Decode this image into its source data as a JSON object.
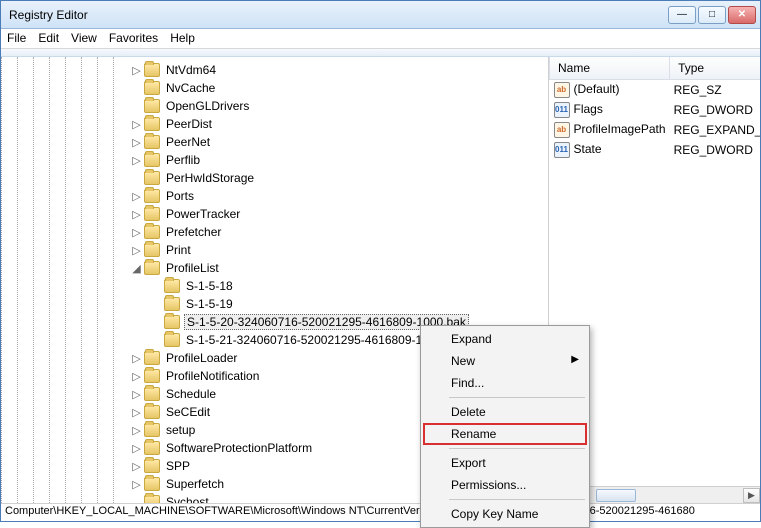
{
  "window": {
    "title": "Registry Editor"
  },
  "menus": [
    "File",
    "Edit",
    "View",
    "Favorites",
    "Help"
  ],
  "tree": {
    "pad_base": 126,
    "items": [
      {
        "tw": "▷",
        "label": "NtVdm64",
        "d": 0
      },
      {
        "tw": "",
        "label": "NvCache",
        "d": 0
      },
      {
        "tw": "",
        "label": "OpenGLDrivers",
        "d": 0
      },
      {
        "tw": "▷",
        "label": "PeerDist",
        "d": 0
      },
      {
        "tw": "▷",
        "label": "PeerNet",
        "d": 0
      },
      {
        "tw": "▷",
        "label": "Perflib",
        "d": 0
      },
      {
        "tw": "",
        "label": "PerHwIdStorage",
        "d": 0
      },
      {
        "tw": "▷",
        "label": "Ports",
        "d": 0
      },
      {
        "tw": "▷",
        "label": "PowerTracker",
        "d": 0
      },
      {
        "tw": "▷",
        "label": "Prefetcher",
        "d": 0
      },
      {
        "tw": "▷",
        "label": "Print",
        "d": 0
      },
      {
        "tw": "◢",
        "label": "ProfileList",
        "d": 0
      },
      {
        "tw": "",
        "label": "S-1-5-18",
        "d": 1
      },
      {
        "tw": "",
        "label": "S-1-5-19",
        "d": 1
      },
      {
        "tw": "",
        "label": "S-1-5-20-324060716-520021295-4616809-1000.bak",
        "d": 1,
        "selected": true
      },
      {
        "tw": "",
        "label": "S-1-5-21-324060716-520021295-4616809-1",
        "d": 1
      },
      {
        "tw": "▷",
        "label": "ProfileLoader",
        "d": 0
      },
      {
        "tw": "▷",
        "label": "ProfileNotification",
        "d": 0
      },
      {
        "tw": "▷",
        "label": "Schedule",
        "d": 0
      },
      {
        "tw": "▷",
        "label": "SeCEdit",
        "d": 0
      },
      {
        "tw": "▷",
        "label": "setup",
        "d": 0
      },
      {
        "tw": "▷",
        "label": "SoftwareProtectionPlatform",
        "d": 0
      },
      {
        "tw": "▷",
        "label": "SPP",
        "d": 0
      },
      {
        "tw": "▷",
        "label": "Superfetch",
        "d": 0
      },
      {
        "tw": "",
        "label": "Svchost",
        "d": 0
      }
    ]
  },
  "list": {
    "columns": [
      "Name",
      "Type"
    ],
    "rows": [
      {
        "icon": "str",
        "name": "(Default)",
        "type": "REG_SZ"
      },
      {
        "icon": "bin",
        "name": "Flags",
        "type": "REG_DWORD"
      },
      {
        "icon": "str",
        "name": "ProfileImagePath",
        "type": "REG_EXPAND_S"
      },
      {
        "icon": "bin",
        "name": "State",
        "type": "REG_DWORD"
      }
    ]
  },
  "context_menu": [
    {
      "label": "Expand"
    },
    {
      "label": "New",
      "submenu": true
    },
    {
      "label": "Find..."
    },
    {
      "sep": true
    },
    {
      "label": "Delete"
    },
    {
      "label": "Rename",
      "highlight": true
    },
    {
      "sep": true
    },
    {
      "label": "Export"
    },
    {
      "label": "Permissions..."
    },
    {
      "sep": true
    },
    {
      "label": "Copy Key Name"
    }
  ],
  "status": "Computer\\HKEY_LOCAL_MACHINE\\SOFTWARE\\Microsoft\\Windows NT\\CurrentVersion\\ProfileList\\S-1-5-20-324060716-520021295-461680"
}
